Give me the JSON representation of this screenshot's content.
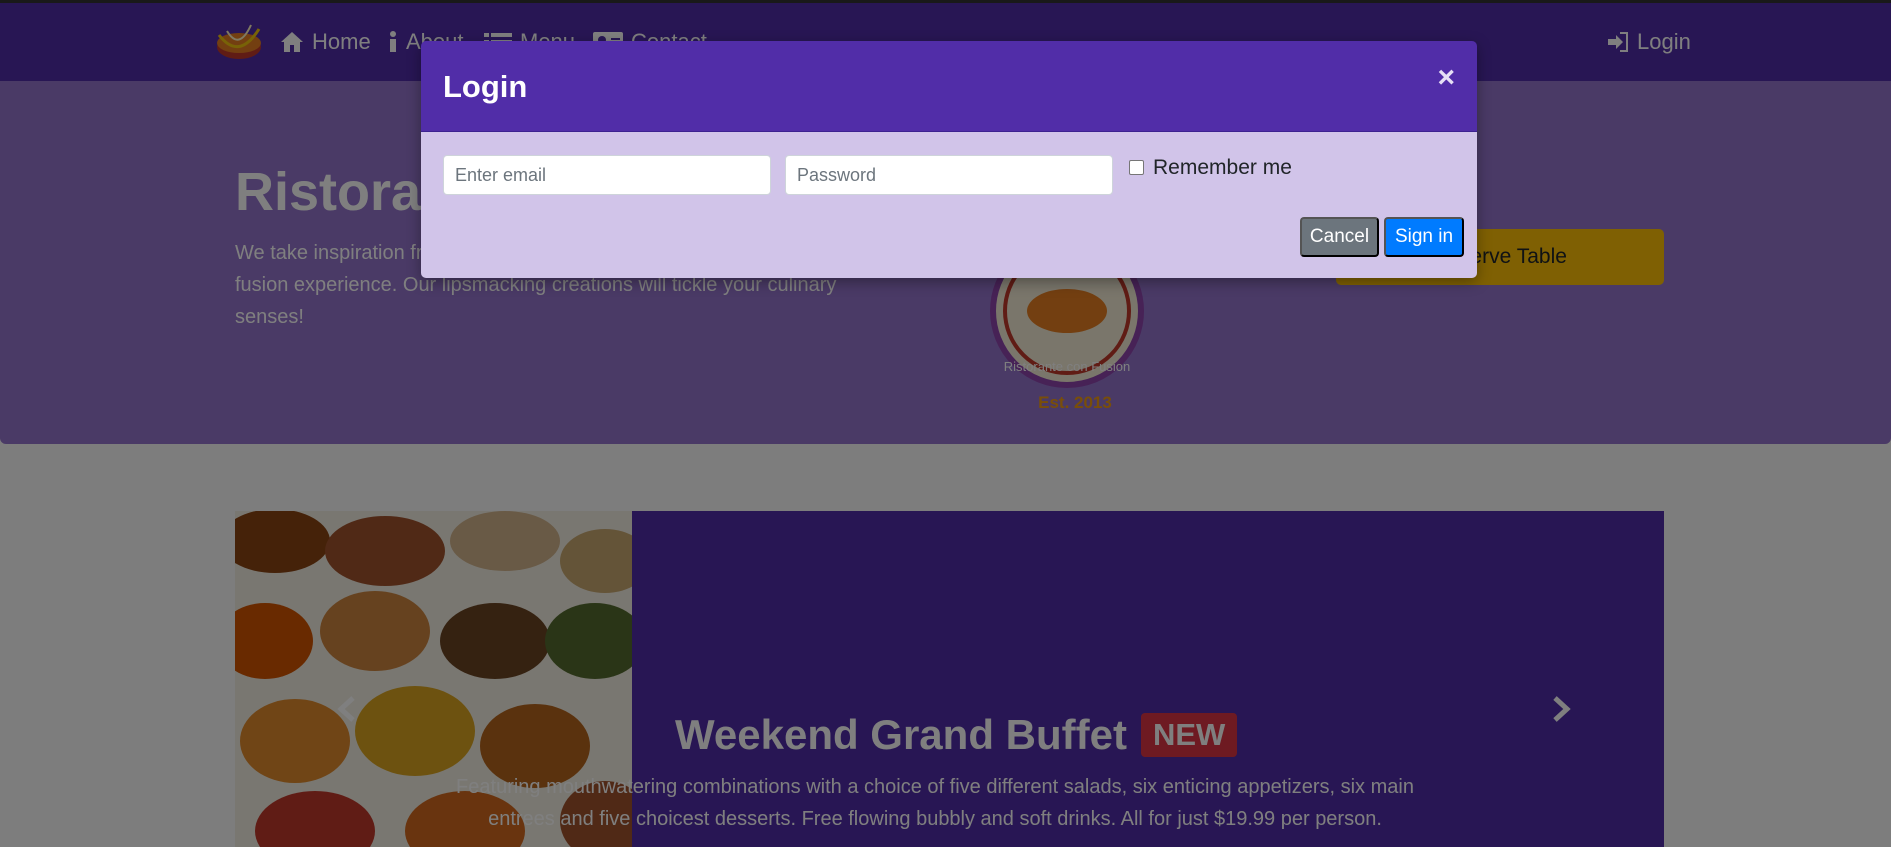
{
  "navbar": {
    "items": [
      {
        "label": "Home",
        "icon": "home-icon"
      },
      {
        "label": "About",
        "icon": "info-icon"
      },
      {
        "label": "Menu",
        "icon": "list-icon"
      },
      {
        "label": "Contact",
        "icon": "address-card-icon"
      }
    ],
    "login_label": "Login",
    "login_icon": "sign-in-icon"
  },
  "jumbotron": {
    "title": "Ristorante con Fusion",
    "text": "We take inspiration from the World's best cuisines, and create a unique fusion experience. Our lipsmacking creations will tickle your culinary senses!",
    "logo_year": "Est. 2013",
    "logo_text": "Ristorante con Fusion",
    "reserve_label": "Reserve Table"
  },
  "carousel": {
    "title": "Weekend Grand Buffet",
    "badge": "NEW",
    "text": "Featuring mouthwatering combinations with a choice of five different salads, six enticing appetizers, six main entrees and five choicest desserts. Free flowing bubbly and soft drinks. All for just $19.99 per person."
  },
  "modal": {
    "title": "Login",
    "close_symbol": "×",
    "email_placeholder": "Enter email",
    "password_placeholder": "Password",
    "remember_label": "Remember me",
    "cancel_label": "Cancel",
    "signin_label": "Sign in"
  },
  "colors": {
    "primary": "#512da8",
    "primary_light": "#9575cd",
    "modal_body": "#d1c4e9",
    "reserve": "#ffc107",
    "badge": "#dc3545",
    "signin": "#007bff",
    "cancel": "#6c757d"
  }
}
